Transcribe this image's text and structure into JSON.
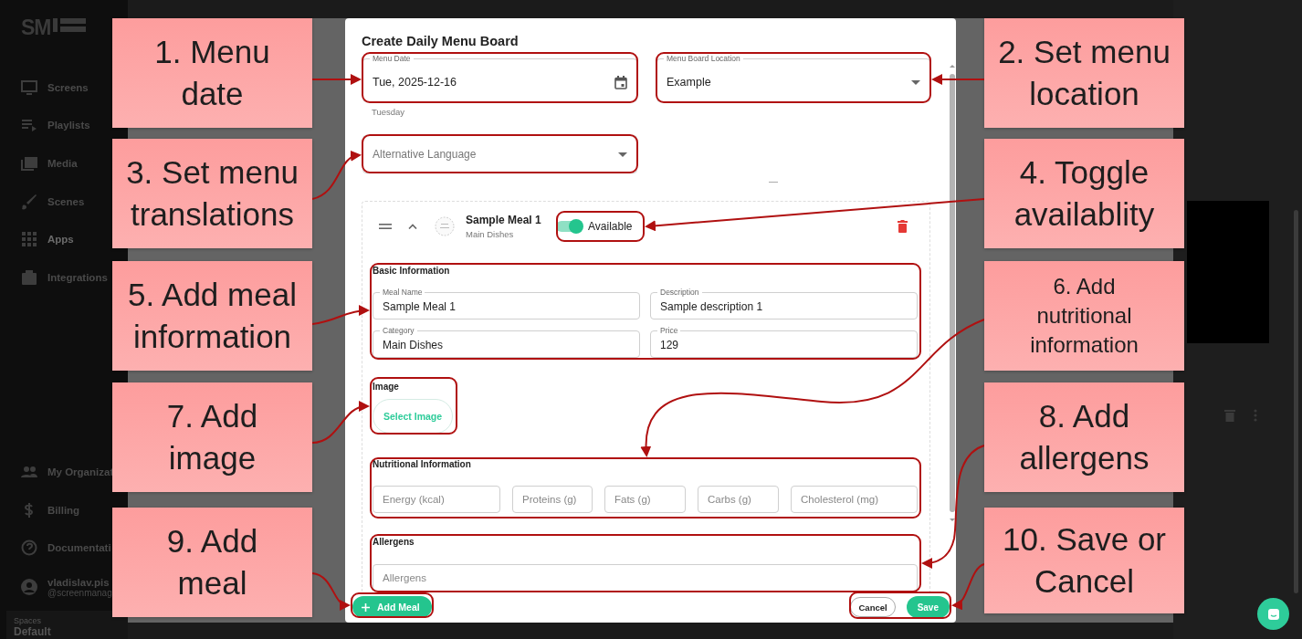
{
  "sidebar": {
    "logo": "SM",
    "items": [
      {
        "label": "Screens",
        "selected": false
      },
      {
        "label": "Playlists",
        "selected": false
      },
      {
        "label": "Media",
        "selected": false
      },
      {
        "label": "Scenes",
        "selected": false
      },
      {
        "label": "Apps",
        "selected": true
      },
      {
        "label": "Integrations",
        "selected": false
      }
    ],
    "bottom_items": [
      {
        "label": "My Organizat"
      },
      {
        "label": "Billing"
      },
      {
        "label": "Documentati"
      }
    ],
    "user": {
      "name": "vladislav.pis",
      "handle": "@screenmanag"
    },
    "spaces": {
      "label": "Spaces",
      "value": "Default"
    }
  },
  "dialog": {
    "title": "Create Daily Menu Board",
    "menu_date": {
      "label": "Menu Date",
      "value": "Tue, 2025-12-16",
      "helper": "Tuesday"
    },
    "location": {
      "label": "Menu Board Location",
      "value": "Example"
    },
    "alt_language": {
      "placeholder": "Alternative Language"
    },
    "meal": {
      "name": "Sample Meal 1",
      "category": "Main Dishes",
      "available": true,
      "available_label": "Available",
      "basic_title": "Basic Information",
      "fields": [
        {
          "label": "Meal Name",
          "value": "Sample Meal 1"
        },
        {
          "label": "Description",
          "value": "Sample description 1"
        },
        {
          "label": "Category",
          "value": "Main Dishes"
        },
        {
          "label": "Price",
          "value": "129"
        }
      ],
      "image_title": "Image",
      "select_image": "Select Image",
      "nutrition_title": "Nutritional Information",
      "nutrition_fields": [
        {
          "placeholder": "Energy (kcal)"
        },
        {
          "placeholder": "Proteins (g)"
        },
        {
          "placeholder": "Fats (g)"
        },
        {
          "placeholder": "Carbs (g)"
        },
        {
          "placeholder": "Cholesterol (mg)"
        }
      ],
      "allergens_title": "Allergens",
      "allergens_placeholder": "Allergens"
    },
    "add_meal": "Add Meal",
    "cancel": "Cancel",
    "save": "Save"
  },
  "annotations": [
    {
      "text": "1. Menu date"
    },
    {
      "text": "2. Set menu location"
    },
    {
      "text": "3. Set menu translations"
    },
    {
      "text": "4. Toggle availablity"
    },
    {
      "text": "5. Add meal information"
    },
    {
      "text": "6. Add nutritional information"
    },
    {
      "text": "7. Add image"
    },
    {
      "text": "8. Add allergens"
    },
    {
      "text": "9. Add meal"
    },
    {
      "text": "10. Save or Cancel"
    }
  ]
}
